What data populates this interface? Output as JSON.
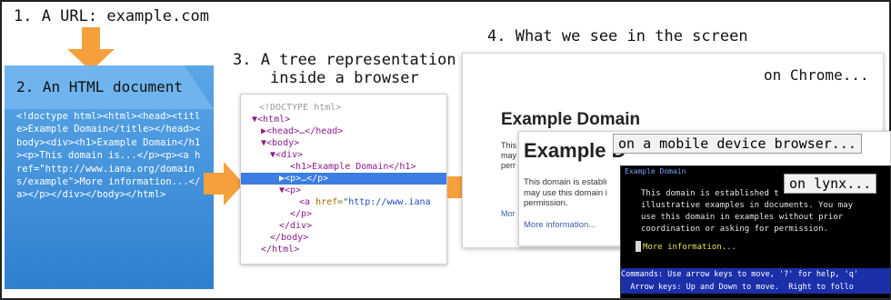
{
  "steps": {
    "step1": "1. A URL: example.com",
    "step2": "2. An HTML document",
    "step3_line1": "3. A tree representation",
    "step3_line2": "inside a browser",
    "step4": "4. What we see in the screen"
  },
  "html_source": "<!doctype html><html><head><title>Example Domain</title></head><body><div><h1>Example Domain</h1><p>This domain is...</p><p><a href=\"http://www.iana.org/domains/example\">More information...</a></p></div></body></html>",
  "tree": {
    "doctype": "<!DOCTYPE html>",
    "html_open": "▼<html>",
    "head": "▶<head>…</head>",
    "body_open": "▼<body>",
    "div_open": "▼<div>",
    "h1": "<h1>Example Domain</h1>",
    "p_selected": "▶<p>…</p>",
    "p_open": "▼<p>",
    "a_tag": "<a",
    "a_attr": "href=",
    "a_val": "\"http://www.iana",
    "p_close": "</p>",
    "div_close": "</div>",
    "body_close": "</body>",
    "html_close": "</html>"
  },
  "browsers": {
    "chrome_label": "on Chrome...",
    "chrome_heading": "Example Domain",
    "chrome_text_lines": [
      "This",
      "may",
      "perr"
    ],
    "chrome_link": "Mor",
    "mobile_label": "on a mobile device browser...",
    "mobile_heading": "Example D",
    "mobile_text_lines": [
      "This domain is establi",
      "may use this domain i",
      "permission."
    ],
    "mobile_link": "More information...",
    "lynx_label": "on lynx...",
    "lynx_title": "Example Domain",
    "lynx_text_lines": [
      "This domain is established t",
      "illustrative examples in documents. You may",
      "use this domain in examples without prior",
      "coordination or asking for permission."
    ],
    "lynx_link": "More information...",
    "lynx_status1": "Commands: Use arrow keys to move, '?' for help, 'q'",
    "lynx_status2": "  Arrow keys: Up and Down to move.  Right to follo"
  },
  "colors": {
    "arrow": "#f5a03c",
    "html_card": "#3a8ad8",
    "tree_selected": "#3b7de0",
    "lynx_bg": "#000000",
    "lynx_status_bg": "#1b2fa8"
  }
}
